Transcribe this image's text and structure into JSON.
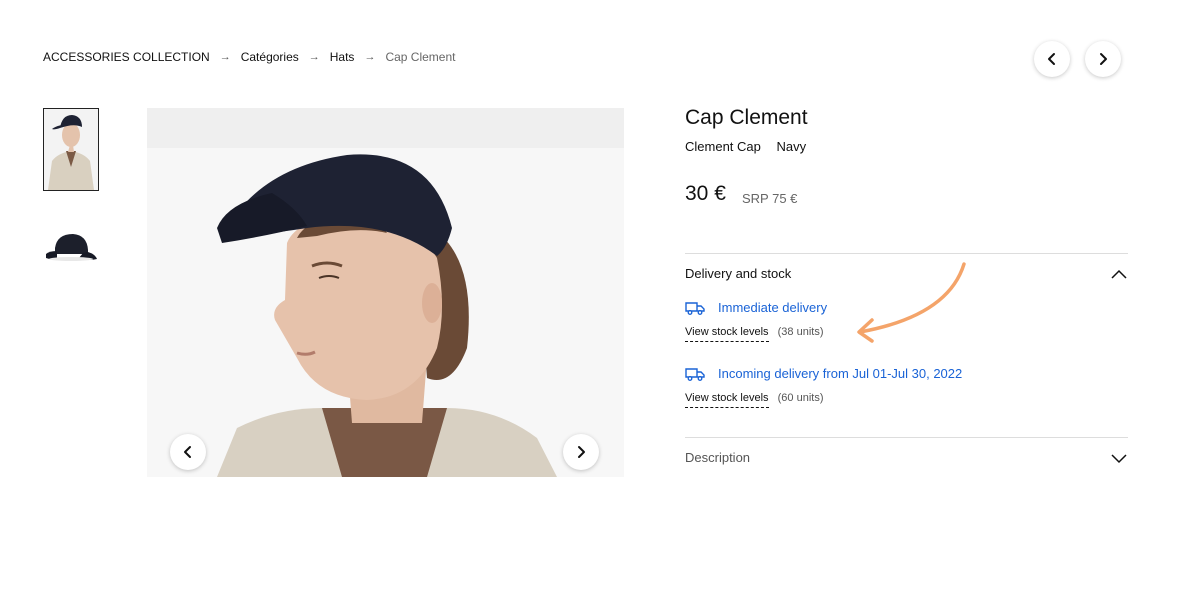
{
  "breadcrumb": {
    "items": [
      "ACCESSORIES COLLECTION",
      "Catégories",
      "Hats",
      "Cap Clement"
    ],
    "separator": "→"
  },
  "product": {
    "title": "Cap Clement",
    "name": "Clement Cap",
    "color": "Navy",
    "price": "30 €",
    "srp": "SRP 75 €"
  },
  "delivery": {
    "section_title": "Delivery and stock",
    "immediate": {
      "label": "Immediate delivery",
      "stock_link": "View stock levels",
      "units": "(38 units)"
    },
    "incoming": {
      "label": "Incoming delivery from Jul 01-Jul 30, 2022",
      "stock_link": "View stock levels",
      "units": "(60 units)"
    }
  },
  "description": {
    "section_title": "Description"
  },
  "icons": {
    "nav_prev": "chevron-left-icon",
    "nav_next": "chevron-right-icon",
    "truck": "truck-icon",
    "expand": "chevron-up-icon",
    "collapse": "chevron-down-icon"
  },
  "colors": {
    "link_blue": "#1a63d6",
    "annotation_orange": "#f4a46a"
  }
}
